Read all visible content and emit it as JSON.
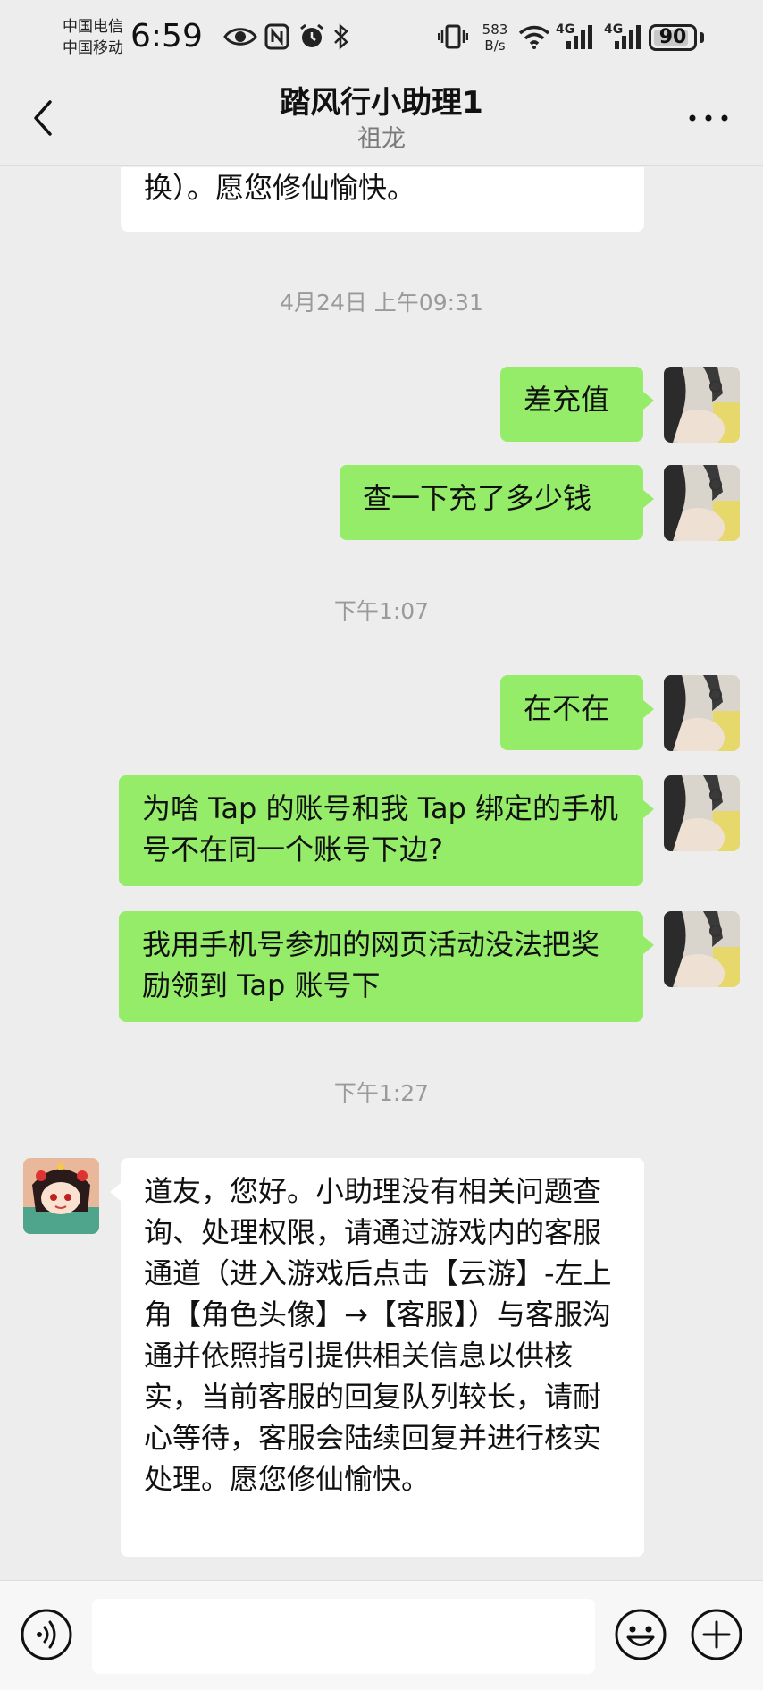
{
  "status_bar": {
    "carrier_1": "中国电信",
    "carrier_2": "中国移动",
    "time": "6:59",
    "net_speed_value": "583",
    "net_speed_unit": "B/s",
    "network_1": "4G",
    "network_2": "4G",
    "battery": "90",
    "battery_level": 0.9
  },
  "header": {
    "title": "踏风行小助理1",
    "subtitle": "祖龙"
  },
  "messages": [
    {
      "text": "换）。愿您修仙愉快。"
    },
    {
      "text": "4月24日 上午09:31"
    },
    {
      "text": "差充值"
    },
    {
      "text": "查一下充了多少钱"
    },
    {
      "text": "下午1:07"
    },
    {
      "text": "在不在"
    },
    {
      "text": "为啥 Tap 的账号和我 Tap 绑定的手机号不在同一个账号下边?"
    },
    {
      "text": "我用手机号参加的网页活动没法把奖励领到 Tap 账号下"
    },
    {
      "text": "下午1:27"
    },
    {
      "text": "道友，您好。小助理没有相关问题查询、处理权限，请通过游戏内的客服通道（进入游戏后点击【云游】-左上角【角色头像】→【客服】）与客服沟通并依照指引提供相关信息以供核实，当前客服的回复队列较长，请耐心等待，客服会陆续回复并进行核实处理。愿您修仙愉快。"
    }
  ],
  "colors": {
    "sent_bubble": "#95ec69",
    "received_bubble": "#ffffff",
    "background": "#ededed"
  },
  "input_bar": {
    "voice_icon": "voice-icon",
    "emoji_icon": "emoji-icon",
    "plus_icon": "plus-icon",
    "value": ""
  }
}
